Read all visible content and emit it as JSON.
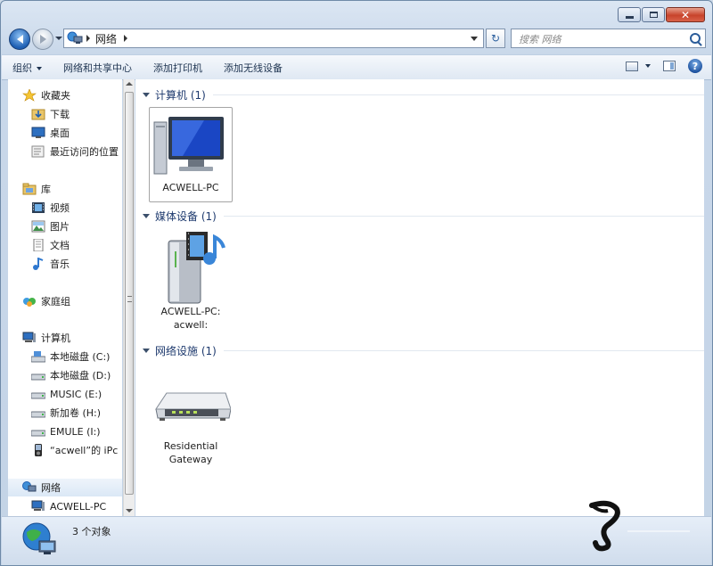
{
  "window": {
    "minimize_label": "",
    "maximize_label": "",
    "close_label": "✕"
  },
  "address": {
    "crumb": "网络",
    "refresh_glyph": "↻",
    "search_placeholder": "搜索 网络"
  },
  "commands": [
    {
      "label": "组织",
      "has_dropdown": true
    },
    {
      "label": "网络和共享中心",
      "has_dropdown": false
    },
    {
      "label": "添加打印机",
      "has_dropdown": false
    },
    {
      "label": "添加无线设备",
      "has_dropdown": false
    }
  ],
  "help_glyph": "?",
  "nav": {
    "favorites": "收藏夹",
    "downloads": "下载",
    "desktop": "桌面",
    "recent": "最近访问的位置",
    "libraries": "库",
    "videos": "视频",
    "pictures": "图片",
    "documents": "文档",
    "music": "音乐",
    "homegroup": "家庭组",
    "computer": "计算机",
    "drive_c": "本地磁盘 (C:)",
    "drive_d": "本地磁盘 (D:)",
    "drive_e": "MUSIC (E:)",
    "drive_h": "新加卷 (H:)",
    "drive_i": "EMULE (I:)",
    "ipod": "“acwell”的 iPc",
    "network": "网络",
    "network_pc": "ACWELL-PC"
  },
  "groups": {
    "computers": "计算机 (1)",
    "media": "媒体设备 (1)",
    "network_infra": "网络设施 (1)"
  },
  "tiles": {
    "pc": "ACWELL-PC",
    "media_line1": "ACWELL-PC:",
    "media_line2": "acwell:",
    "gateway_line1": "Residential",
    "gateway_line2": "Gateway"
  },
  "status": {
    "count": "3 个对象"
  },
  "colors": {
    "accent": "#1e5fb3",
    "group_header": "#1e3a6e",
    "selection": "#dbe8f6"
  }
}
